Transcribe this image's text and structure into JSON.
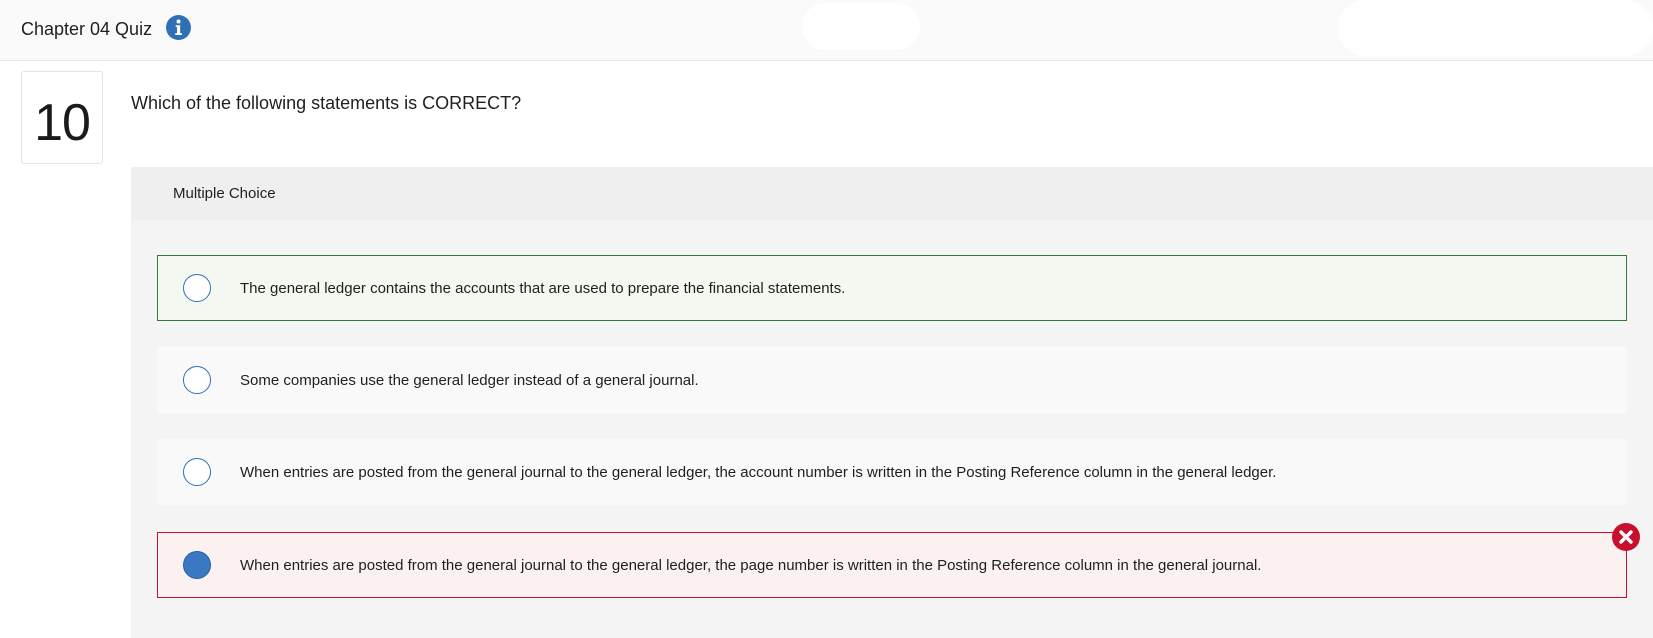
{
  "header": {
    "quiz_title": "Chapter 04 Quiz",
    "info_icon": "info-icon"
  },
  "question": {
    "number": "10",
    "text": "Which of the following statements is CORRECT?",
    "type_label": "Multiple Choice"
  },
  "options": [
    {
      "text": "The general ledger contains the accounts that are used to prepare the financial statements.",
      "selected": false,
      "state": "correct"
    },
    {
      "text": "Some companies use the general ledger instead of a general journal.",
      "selected": false,
      "state": "neutral"
    },
    {
      "text": "When entries are posted from the general journal to the general ledger, the account number is written in the Posting Reference column in the general ledger.",
      "selected": false,
      "state": "neutral"
    },
    {
      "text": "When entries are posted from the general journal to the general ledger, the page number is written in the Posting Reference column in the general journal.",
      "selected": true,
      "state": "incorrect"
    }
  ],
  "colors": {
    "accent_blue": "#3a79c1",
    "correct_green": "#2f7d32",
    "incorrect_red": "#c8102e"
  },
  "icons": {
    "incorrect_marker": "close-circle-icon"
  }
}
